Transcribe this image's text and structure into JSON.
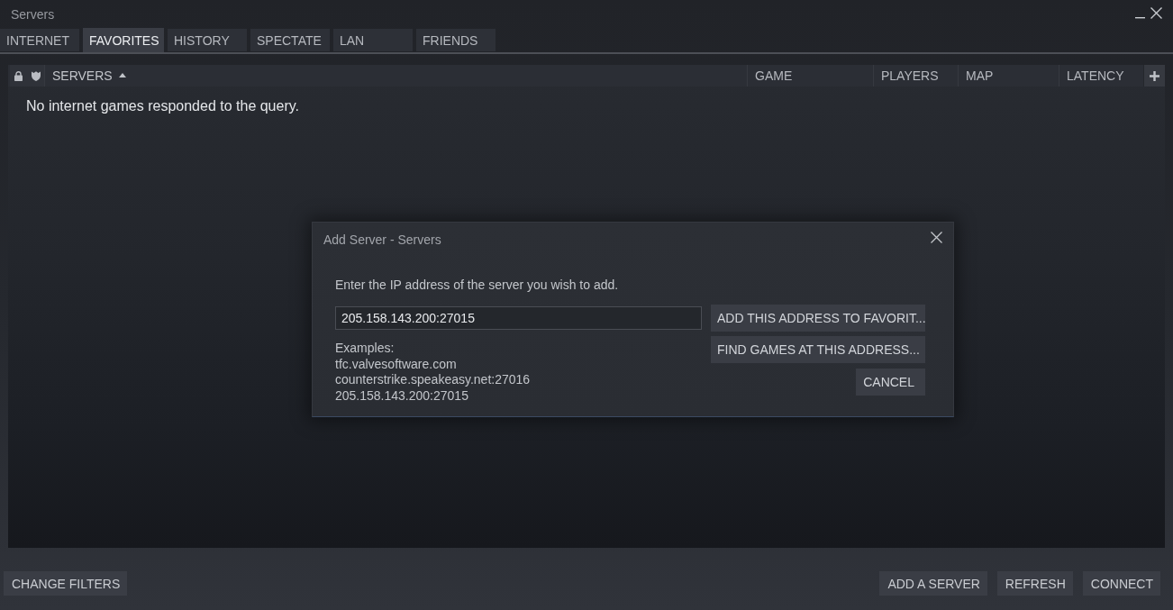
{
  "window": {
    "title": "Servers"
  },
  "tabs": [
    {
      "label": "INTERNET",
      "selected": false
    },
    {
      "label": "FAVORITES",
      "selected": true
    },
    {
      "label": "HISTORY",
      "selected": false
    },
    {
      "label": "SPECTATE",
      "selected": false
    },
    {
      "label": "LAN",
      "selected": false
    },
    {
      "label": "FRIENDS",
      "selected": false
    }
  ],
  "table": {
    "columns": [
      {
        "label": "SERVERS",
        "sorted": true
      },
      {
        "label": "GAME",
        "sorted": false
      },
      {
        "label": "PLAYERS",
        "sorted": false
      },
      {
        "label": "MAP",
        "sorted": false
      },
      {
        "label": "LATENCY",
        "sorted": false
      }
    ],
    "empty_message": "No internet games responded to the query."
  },
  "dialog": {
    "title": "Add Server - Servers",
    "instruction": "Enter the IP address of the server you wish to add.",
    "address_field": {
      "value": "205.158.143.200:27015"
    },
    "examples": {
      "heading": "Examples:",
      "items": [
        "tfc.valvesoftware.com",
        "counterstrike.speakeasy.net:27016",
        "205.158.143.200:27015"
      ]
    },
    "buttons": [
      "ADD THIS ADDRESS TO FAVORIT...",
      "FIND GAMES AT THIS ADDRESS...",
      "CANCEL"
    ]
  },
  "footer": {
    "left_buttons": [
      "CHANGE FILTERS"
    ],
    "right_buttons": [
      "ADD A SERVER",
      "REFRESH",
      "CONNECT"
    ]
  }
}
